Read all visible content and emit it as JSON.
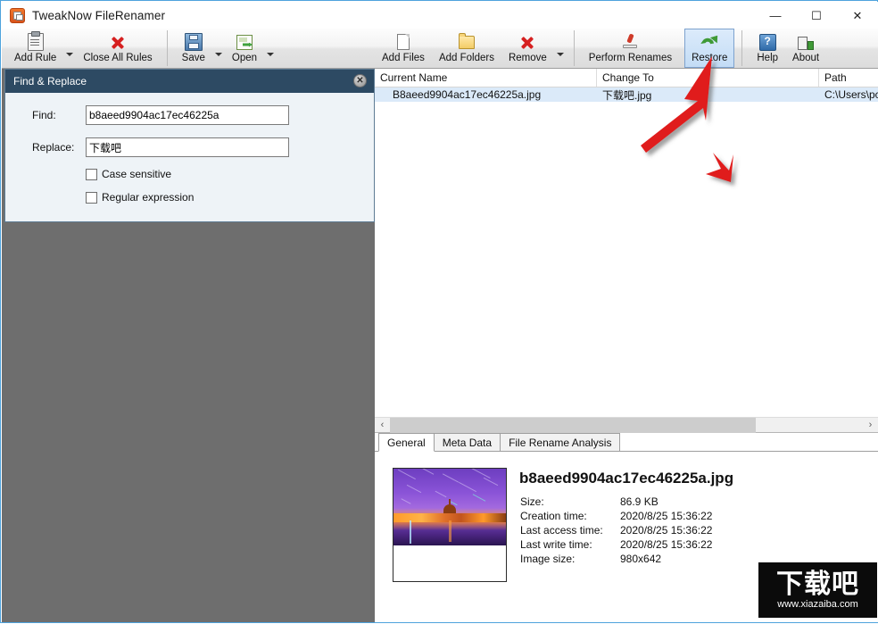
{
  "window": {
    "title": "TweakNow FileRenamer",
    "app_icon": "app-document-icon",
    "minimize": "—",
    "maximize": "☐",
    "close": "✕"
  },
  "toolbar": {
    "left_group": [
      {
        "label": "Add Rule",
        "icon": "clipboard-icon",
        "has_dropdown": true,
        "selected": false
      },
      {
        "label": "Close All Rules",
        "icon": "red-x-icon",
        "has_dropdown": false,
        "selected": false
      }
    ],
    "left_group2": [
      {
        "label": "Save",
        "icon": "floppy-disk-icon",
        "has_dropdown": true,
        "selected": false
      },
      {
        "label": "Open",
        "icon": "open-folder-arrow-icon",
        "has_dropdown": true,
        "selected": false
      }
    ],
    "right_group": [
      {
        "label": "Add Files",
        "icon": "file-icon",
        "has_dropdown": false,
        "selected": false
      },
      {
        "label": "Add Folders",
        "icon": "folder-icon",
        "has_dropdown": false,
        "selected": false
      },
      {
        "label": "Remove",
        "icon": "red-x-icon",
        "has_dropdown": true,
        "selected": false
      }
    ],
    "right_group2": [
      {
        "label": "Perform Renames",
        "icon": "stamp-icon",
        "has_dropdown": false,
        "selected": false
      },
      {
        "label": "Restore",
        "icon": "restore-arrow-icon",
        "has_dropdown": false,
        "selected": true
      },
      {
        "label": "Help",
        "icon": "question-mark-icon",
        "has_dropdown": false,
        "selected": false
      },
      {
        "label": "About",
        "icon": "info-building-icon",
        "has_dropdown": false,
        "selected": false
      }
    ],
    "help_glyph": "?"
  },
  "find_replace_panel": {
    "title": "Find & Replace",
    "close_glyph": "✕",
    "find_label": "Find:",
    "find_value": "b8aeed9904ac17ec46225a",
    "replace_label": "Replace:",
    "replace_value": "下载吧",
    "case_sensitive_label": "Case sensitive",
    "case_sensitive_checked": false,
    "regex_label": "Regular expression",
    "regex_checked": false
  },
  "file_list": {
    "columns": [
      "Current Name",
      "Change To",
      "Path"
    ],
    "rows": [
      {
        "current_name": "B8aeed9904ac17ec46225a.jpg",
        "change_to": "下载吧.jpg",
        "path": "C:\\Users\\pc",
        "selected": true
      }
    ],
    "scroll_left_glyph": "‹",
    "scroll_right_glyph": "›"
  },
  "detail": {
    "tabs": [
      {
        "label": "General",
        "active": true
      },
      {
        "label": "Meta Data",
        "active": false
      },
      {
        "label": "File Rename Analysis",
        "active": false
      }
    ],
    "thumbnail": "night-city-skyline-thumbnail",
    "file_name": "b8aeed9904ac17ec46225a.jpg",
    "properties": [
      {
        "key": "Size:",
        "value": "86.9 KB"
      },
      {
        "key": "Creation time:",
        "value": "2020/8/25 15:36:22"
      },
      {
        "key": "Last access time:",
        "value": "2020/8/25 15:36:22"
      },
      {
        "key": "Last write time:",
        "value": "2020/8/25 15:36:22"
      },
      {
        "key": "Image size:",
        "value": "980x642"
      }
    ]
  },
  "annotations": {
    "arrow_1": "red-arrow-pointing-to-restore-button",
    "arrow_2": "red-arrow-pointing-down"
  },
  "watermark": {
    "text_cn": "下载吧",
    "url": "www.xiazaiba.com"
  },
  "colors": {
    "window_border": "#4ea3dd",
    "panel_header": "#2d4a63",
    "selection": "#dbeaf9",
    "toolbar_selected": "#c3dcf5",
    "annotation_red": "#e01b1b",
    "left_gray": "#6e6e6e"
  }
}
